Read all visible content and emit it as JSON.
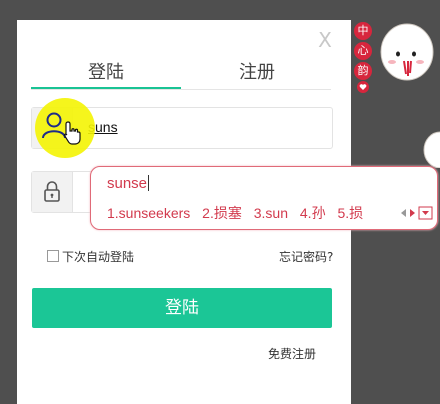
{
  "dialog": {
    "close_label": "X",
    "tabs": [
      {
        "label": "登陆",
        "active": true
      },
      {
        "label": "注册",
        "active": false
      }
    ],
    "username": {
      "value": "suns"
    },
    "remember_label": "下次自动登陆",
    "forgot_label": "忘记密码?",
    "login_button": "登陆",
    "free_register": "免费注册",
    "accent_color": "#19c394"
  },
  "ime": {
    "composition": "sunse",
    "candidates": [
      "1.sunseekers",
      "2.损塞",
      "3.sun",
      "4.孙",
      "5.损"
    ],
    "text_color": "#d23a4d"
  },
  "decoration": {
    "stamps": [
      "中",
      "心",
      "韵"
    ]
  }
}
